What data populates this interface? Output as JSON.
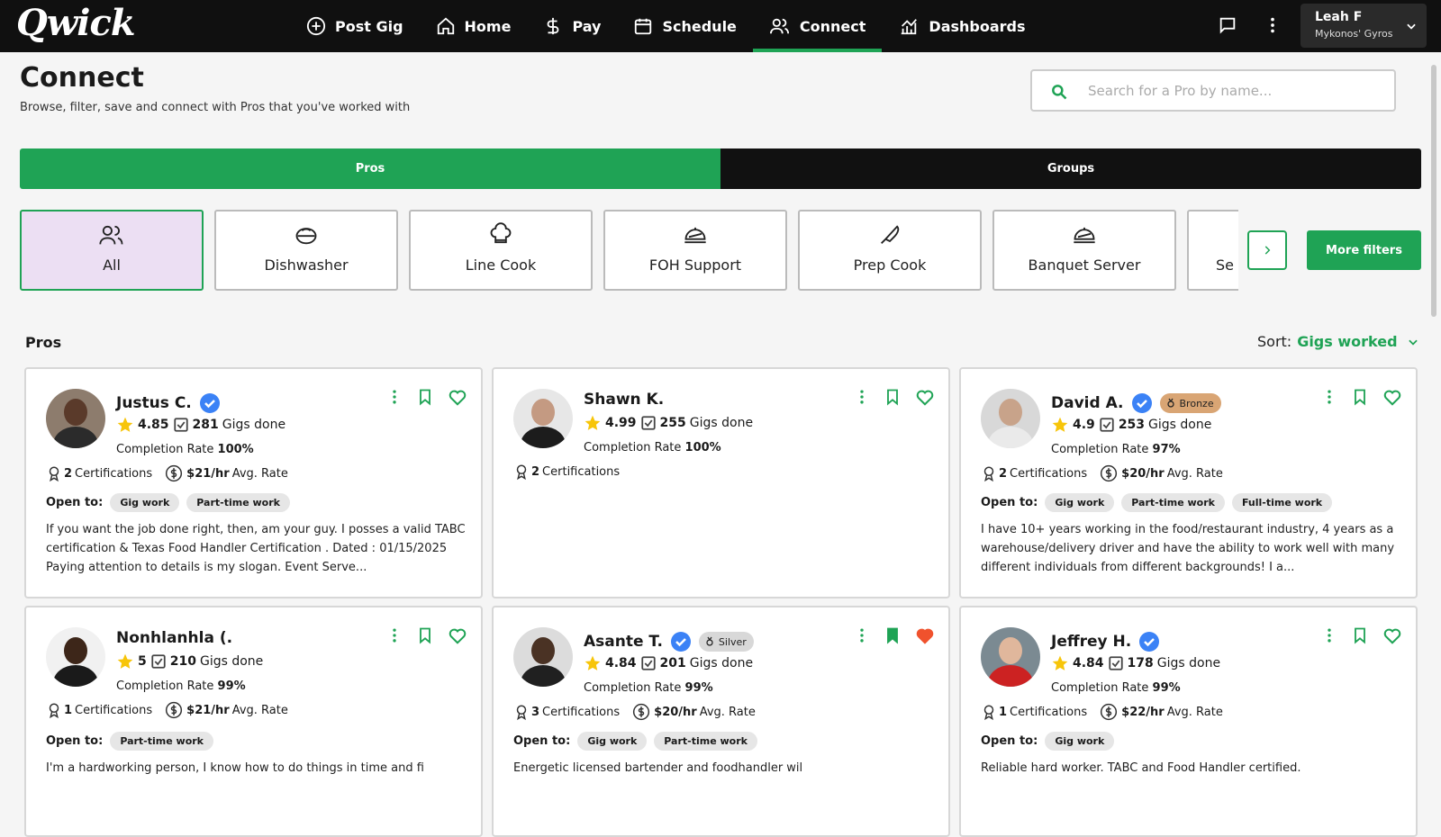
{
  "app": {
    "logo": "Qwick"
  },
  "nav": [
    {
      "label": "Post Gig",
      "icon": "plus-circle-icon"
    },
    {
      "label": "Home",
      "icon": "home-icon"
    },
    {
      "label": "Pay",
      "icon": "dollar-icon"
    },
    {
      "label": "Schedule",
      "icon": "calendar-icon"
    },
    {
      "label": "Connect",
      "icon": "people-icon",
      "active": true
    },
    {
      "label": "Dashboards",
      "icon": "chart-icon"
    }
  ],
  "user": {
    "name": "Leah F",
    "business": "Mykonos' Gyros"
  },
  "page": {
    "title": "Connect",
    "subtitle": "Browse, filter, save and connect with Pros that you've worked with"
  },
  "search": {
    "placeholder": "Search for a Pro by name..."
  },
  "segments": {
    "pros": "Pros",
    "groups": "Groups"
  },
  "categories": [
    {
      "label": "All",
      "icon": "people-icon",
      "selected": true
    },
    {
      "label": "Dishwasher",
      "icon": "dish-icon"
    },
    {
      "label": "Line Cook",
      "icon": "chef-hat-icon"
    },
    {
      "label": "FOH Support",
      "icon": "cloche-icon"
    },
    {
      "label": "Prep Cook",
      "icon": "knife-icon"
    },
    {
      "label": "Banquet Server",
      "icon": "cloche-icon"
    },
    {
      "label": "Se",
      "icon": ""
    }
  ],
  "filters": {
    "more": "More filters"
  },
  "list": {
    "title": "Pros",
    "sort_label": "Sort:",
    "sort_value": "Gigs worked"
  },
  "labels": {
    "gigs_done": "Gigs done",
    "completion": "Completion Rate",
    "certifications": "Certifications",
    "avg_rate": "Avg. Rate",
    "open_to": "Open to:"
  },
  "pros": [
    {
      "name": "Justus C.",
      "verified": true,
      "tier": "",
      "rating": "4.85",
      "gigs": "281",
      "completion": "100%",
      "certs": "2",
      "rate": "$21/hr",
      "open_to": [
        "Gig work",
        "Part-time work"
      ],
      "bio": "If you want the job done right, then, am your guy. I posses a valid TABC certification & Texas Food Handler Certification . Dated : 01/15/2025 Paying attention to details is my slogan. Event Serve...",
      "saved": false,
      "favorite": false
    },
    {
      "name": "Shawn K.",
      "verified": false,
      "tier": "",
      "rating": "4.99",
      "gigs": "255",
      "completion": "100%",
      "certs": "2",
      "rate": "",
      "open_to": [],
      "bio": "",
      "saved": false,
      "favorite": false
    },
    {
      "name": "David A.",
      "verified": true,
      "tier": "Bronze",
      "rating": "4.9",
      "gigs": "253",
      "completion": "97%",
      "certs": "2",
      "rate": "$20/hr",
      "open_to": [
        "Gig work",
        "Part-time work",
        "Full-time work"
      ],
      "bio": "I have 10+ years working in the food/restaurant industry, 4 years as a warehouse/delivery driver and have the ability to work well with many different individuals from different backgrounds! I a...",
      "saved": false,
      "favorite": false
    },
    {
      "name": "Nonhlanhla (.",
      "verified": false,
      "tier": "",
      "rating": "5",
      "gigs": "210",
      "completion": "99%",
      "certs": "1",
      "rate": "$21/hr",
      "open_to": [
        "Part-time work"
      ],
      "bio": "I'm a hardworking person, I know how to do things in time and fi",
      "saved": false,
      "favorite": false
    },
    {
      "name": "Asante T.",
      "verified": true,
      "tier": "Silver",
      "rating": "4.84",
      "gigs": "201",
      "completion": "99%",
      "certs": "3",
      "rate": "$20/hr",
      "open_to": [
        "Gig work",
        "Part-time work"
      ],
      "bio": "Energetic licensed bartender and foodhandler wil",
      "saved": true,
      "favorite": true
    },
    {
      "name": "Jeffrey H.",
      "verified": true,
      "tier": "",
      "rating": "4.84",
      "gigs": "178",
      "completion": "99%",
      "certs": "1",
      "rate": "$22/hr",
      "open_to": [
        "Gig work"
      ],
      "bio": "Reliable hard worker. TABC and Food Handler certified.",
      "saved": false,
      "favorite": false
    }
  ],
  "colors": {
    "accent": "#1fa355",
    "bronze": "#d9a574",
    "silver": "#d8d8d8",
    "star": "#f7c50a",
    "verified": "#3b82f6",
    "favorite": "#f0522d"
  }
}
